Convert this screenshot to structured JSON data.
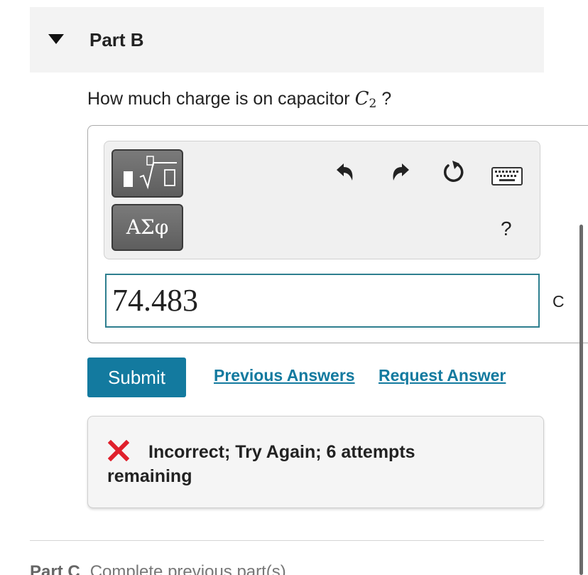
{
  "part": {
    "title": "Part B"
  },
  "question": {
    "prefix": "How much charge is on capacitor ",
    "variable": "C",
    "subscript": "2",
    "suffix": " ?"
  },
  "toolbar": {
    "templates_icon": "templates-sqrt-icon",
    "symbols_label": "ΑΣφ",
    "undo_icon": "undo-icon",
    "redo_icon": "redo-icon",
    "reset_icon": "reset-icon",
    "keyboard_icon": "keyboard-icon",
    "help_label": "?"
  },
  "answer": {
    "value": "74.483",
    "unit": "C"
  },
  "actions": {
    "submit_label": "Submit",
    "previous_answers_label": "Previous Answers",
    "request_answer_label": "Request Answer"
  },
  "feedback": {
    "icon": "x-icon",
    "message": "Incorrect; Try Again; 6 attempts remaining"
  },
  "next_part": {
    "title": "Part C",
    "status": "Complete previous part(s)"
  },
  "colors": {
    "accent": "#137a9f",
    "input_border": "#2e7f8f",
    "error": "#e0202c"
  }
}
